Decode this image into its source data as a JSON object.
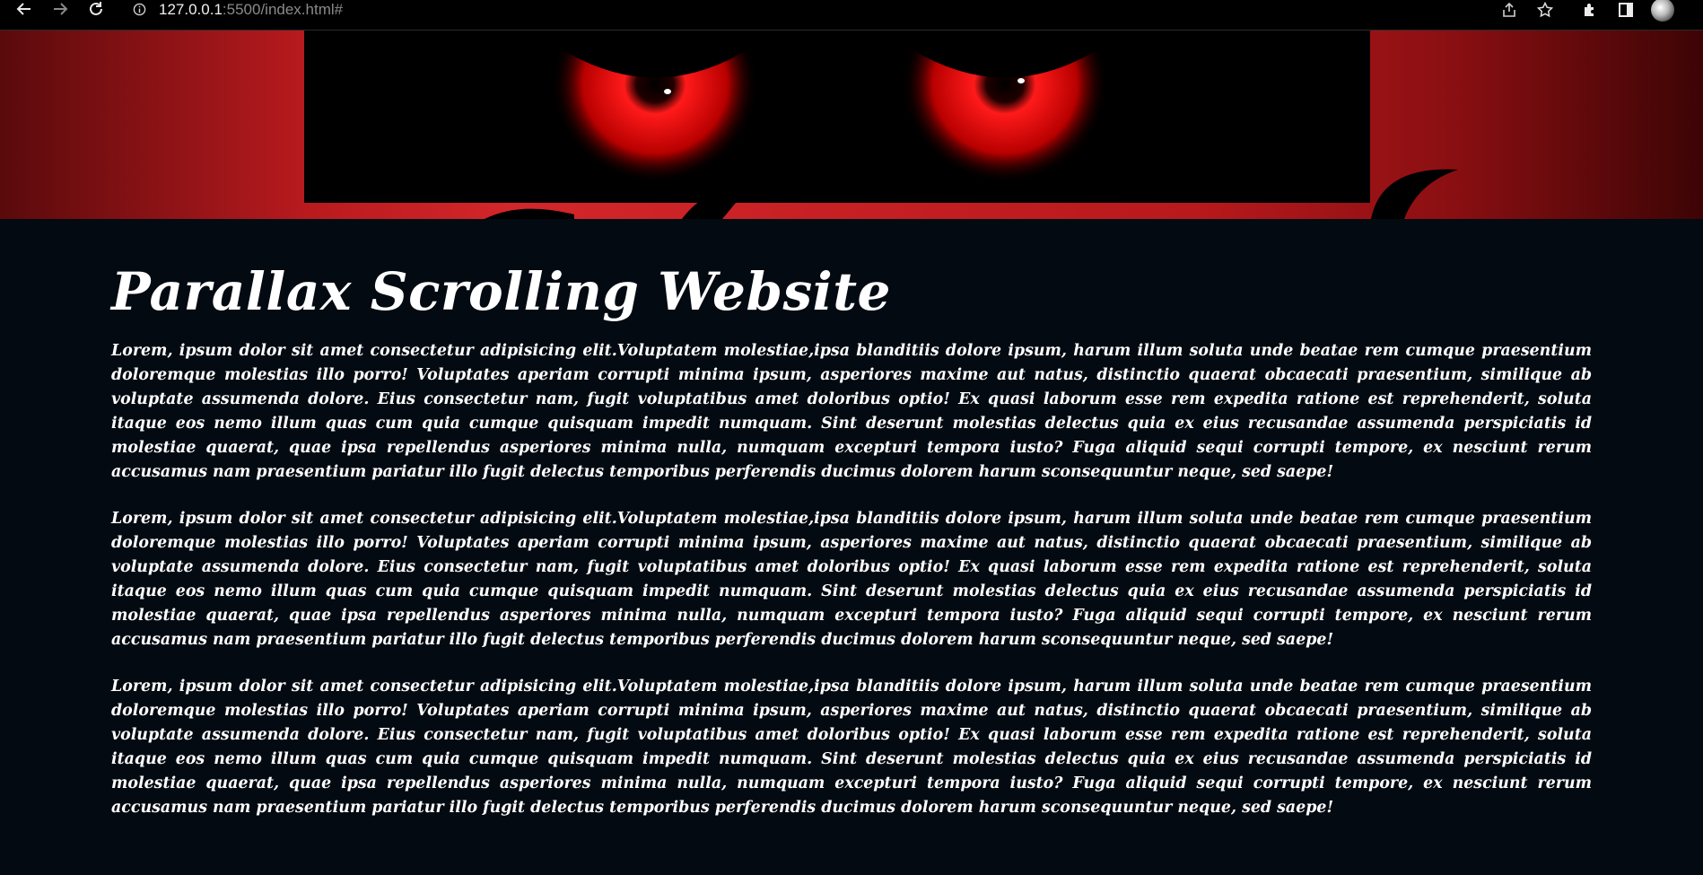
{
  "browser": {
    "url_host": "127.0.0.1",
    "url_rest": ":5500/index.html#",
    "icons": [
      "back-arrow-icon",
      "forward-arrow-icon",
      "reload-icon",
      "info-icon",
      "share-icon",
      "star-icon",
      "extensions-icon",
      "side-panel-icon",
      "profile-avatar"
    ]
  },
  "hero": {
    "description_colors": {
      "accent": "#d3262a",
      "eye": "#e0121a",
      "dark": "#000000"
    }
  },
  "main": {
    "title": "Parallax Scrolling Website",
    "paragraphs": [
      "Lorem, ipsum dolor sit amet consectetur adipisicing elit.Voluptatem molestiae,ipsa blanditiis dolore ipsum, harum illum soluta unde beatae rem cumque praesentium doloremque molestias illo porro! Voluptates aperiam corrupti minima ipsum, asperiores maxime aut natus, distinctio quaerat obcaecati praesentium, similique ab voluptate assumenda dolore. Eius consectetur nam, fugit voluptatibus amet doloribus optio! Ex quasi laborum esse rem expedita ratione est reprehenderit, soluta itaque eos nemo illum quas cum quia cumque quisquam impedit numquam. Sint deserunt molestias delectus quia ex eius recusandae assumenda perspiciatis id molestiae quaerat, quae ipsa repellendus asperiores minima nulla, numquam excepturi tempora iusto? Fuga aliquid sequi corrupti tempore, ex nesciunt rerum accusamus nam praesentium pariatur illo fugit delectus temporibus perferendis ducimus dolorem harum sconsequuntur neque, sed saepe!",
      "Lorem, ipsum dolor sit amet consectetur adipisicing elit.Voluptatem molestiae,ipsa blanditiis dolore ipsum, harum illum soluta unde beatae rem cumque praesentium doloremque molestias illo porro! Voluptates aperiam corrupti minima ipsum, asperiores maxime aut natus, distinctio quaerat obcaecati praesentium, similique ab voluptate assumenda dolore. Eius consectetur nam, fugit voluptatibus amet doloribus optio! Ex quasi laborum esse rem expedita ratione est reprehenderit, soluta itaque eos nemo illum quas cum quia cumque quisquam impedit numquam. Sint deserunt molestias delectus quia ex eius recusandae assumenda perspiciatis id molestiae quaerat, quae ipsa repellendus asperiores minima nulla, numquam excepturi tempora iusto? Fuga aliquid sequi corrupti tempore, ex nesciunt rerum accusamus nam praesentium pariatur illo fugit delectus temporibus perferendis ducimus dolorem harum sconsequuntur neque, sed saepe!",
      "Lorem, ipsum dolor sit amet consectetur adipisicing elit.Voluptatem molestiae,ipsa blanditiis dolore ipsum, harum illum soluta unde beatae rem cumque praesentium doloremque molestias illo porro! Voluptates aperiam corrupti minima ipsum, asperiores maxime aut natus, distinctio quaerat obcaecati praesentium, similique ab voluptate assumenda dolore. Eius consectetur nam, fugit voluptatibus amet doloribus optio! Ex quasi laborum esse rem expedita ratione est reprehenderit, soluta itaque eos nemo illum quas cum quia cumque quisquam impedit numquam. Sint deserunt molestias delectus quia ex eius recusandae assumenda perspiciatis id molestiae quaerat, quae ipsa repellendus asperiores minima nulla, numquam excepturi tempora iusto? Fuga aliquid sequi corrupti tempore, ex nesciunt rerum accusamus nam praesentium pariatur illo fugit delectus temporibus perferendis ducimus dolorem harum sconsequuntur neque, sed saepe!"
    ]
  }
}
